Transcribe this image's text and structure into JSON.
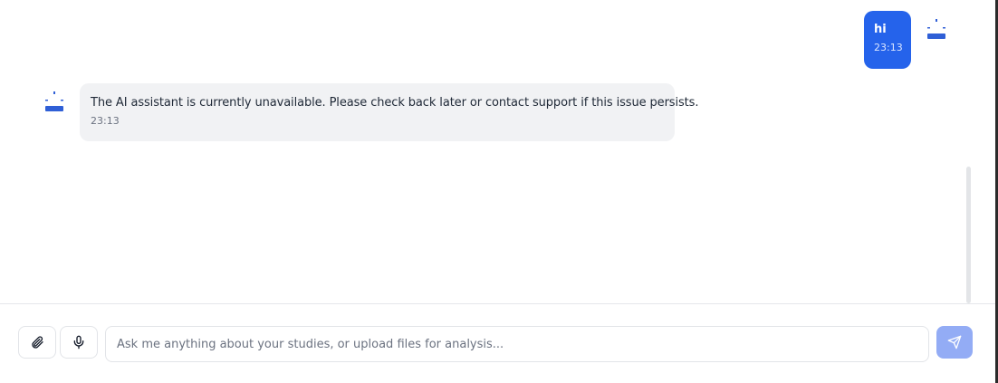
{
  "chat": {
    "messages": [
      {
        "role": "user",
        "text": "hi",
        "time": "23:13"
      },
      {
        "role": "assistant",
        "text": "The AI assistant is currently unavailable. Please check back later or contact support if this issue persists.",
        "time": "23:13"
      }
    ]
  },
  "composer": {
    "placeholder": "Ask me anything about your studies, or upload files for analysis...",
    "value": "",
    "attach_icon": "paperclip-icon",
    "mic_icon": "microphone-icon",
    "send_icon": "send-icon"
  },
  "colors": {
    "user_bubble": "#2563eb",
    "assistant_bubble": "#f1f2f4",
    "send_button": "#93acf5",
    "avatar_accent": "#2f5fd6"
  }
}
